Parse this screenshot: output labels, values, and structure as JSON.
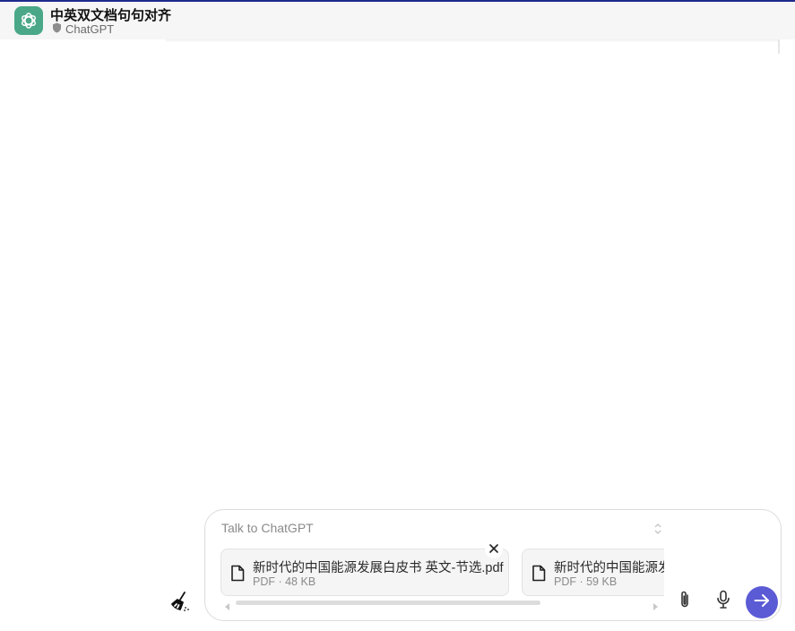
{
  "header": {
    "title": "中英双文档句句对齐",
    "subtitle": "ChatGPT",
    "app_icon": "openai-logo-icon",
    "shield_icon": "shield-icon"
  },
  "composer": {
    "placeholder": "Talk to ChatGPT",
    "attachments": [
      {
        "name": "新时代的中国能源发展白皮书 英文-节选.pdf",
        "meta": "PDF · 48 KB"
      },
      {
        "name": "新时代的中国能源发展白皮书 中文-节选.pdf",
        "meta": "PDF · 59 KB"
      }
    ],
    "icons": {
      "clear": "broom-icon",
      "attach": "paperclip-icon",
      "mic": "microphone-icon",
      "send": "arrow-right-icon",
      "remove": "close-icon",
      "file": "document-icon"
    }
  },
  "colors": {
    "accent": "#5b5bd6",
    "brand": "#4aa889",
    "topline": "#1e2a8c"
  }
}
